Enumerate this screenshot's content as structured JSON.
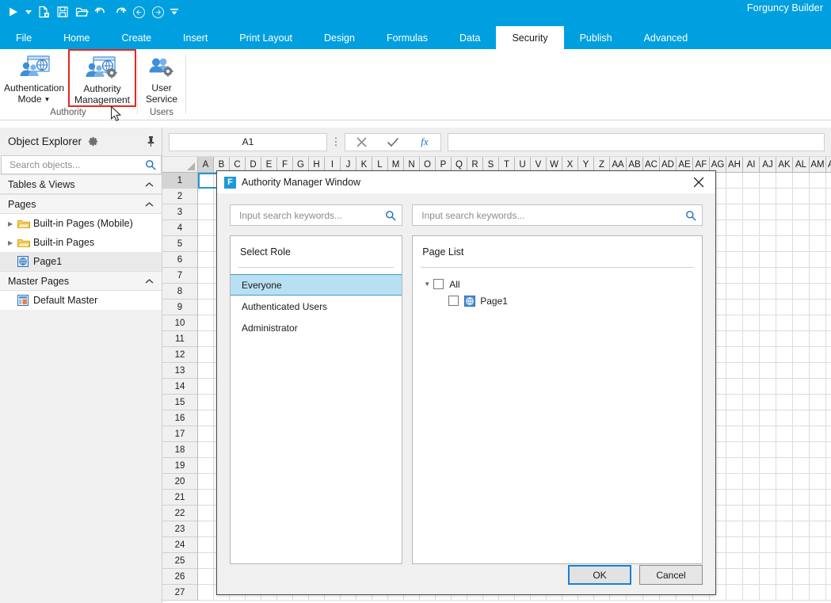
{
  "app": {
    "title": "Forguncy Builder",
    "accent": "#00a0e0",
    "selection_color": "#1c9ad6",
    "highlight_red": "#e8261d"
  },
  "quick_access": [
    {
      "name": "run-icon",
      "label": "Run"
    },
    {
      "name": "run-dropdown-icon",
      "label": "Run options"
    },
    {
      "name": "new-file-icon",
      "label": "New"
    },
    {
      "name": "save-icon",
      "label": "Save"
    },
    {
      "name": "open-folder-icon",
      "label": "Open"
    },
    {
      "name": "undo-icon",
      "label": "Undo"
    },
    {
      "name": "redo-icon",
      "label": "Redo"
    },
    {
      "name": "back-icon",
      "label": "Back"
    },
    {
      "name": "forward-icon",
      "label": "Forward"
    },
    {
      "name": "customize-toolbar-icon",
      "label": "Customize"
    }
  ],
  "tabs": [
    {
      "label": "File",
      "active": false
    },
    {
      "label": "Home",
      "active": false
    },
    {
      "label": "Create",
      "active": false
    },
    {
      "label": "Insert",
      "active": false
    },
    {
      "label": "Print Layout",
      "active": false
    },
    {
      "label": "Design",
      "active": false
    },
    {
      "label": "Formulas",
      "active": false
    },
    {
      "label": "Data",
      "active": false
    },
    {
      "label": "Security",
      "active": true
    },
    {
      "label": "Publish",
      "active": false
    },
    {
      "label": "Advanced",
      "active": false
    }
  ],
  "ribbon": {
    "groups": [
      {
        "label": "Authority",
        "buttons": [
          {
            "label_line1": "Authentication",
            "label_line2": "Mode",
            "has_caret": true,
            "selected": false,
            "icon": "authentication-mode-icon"
          },
          {
            "label_line1": "Authority",
            "label_line2": "Management",
            "has_caret": false,
            "selected": true,
            "icon": "authority-management-icon"
          }
        ]
      },
      {
        "label": "Users",
        "buttons": [
          {
            "label_line1": "User",
            "label_line2": "Service",
            "has_caret": false,
            "selected": false,
            "icon": "user-service-icon"
          }
        ]
      }
    ]
  },
  "object_explorer": {
    "title": "Object Explorer",
    "search_placeholder": "Search objects...",
    "search_value": "",
    "sections": [
      {
        "label": "Tables & Views",
        "expanded": true,
        "items": []
      },
      {
        "label": "Pages",
        "expanded": true,
        "items": [
          {
            "label": "Built-in Pages (Mobile)",
            "icon": "folder-icon",
            "arrow": true,
            "selected": false
          },
          {
            "label": "Built-in Pages",
            "icon": "folder-icon",
            "arrow": true,
            "selected": false
          },
          {
            "label": "Page1",
            "icon": "page-icon",
            "arrow": false,
            "selected": true
          }
        ]
      },
      {
        "label": "Master Pages",
        "expanded": true,
        "items": [
          {
            "label": "Default Master",
            "icon": "master-page-icon",
            "arrow": false,
            "selected": false
          }
        ]
      }
    ]
  },
  "formula_bar": {
    "name_box": "A1",
    "formula_value": "",
    "cancel_label": "✕",
    "confirm_label": "✓",
    "fx_label": "fx"
  },
  "grid": {
    "columns": [
      "A",
      "B",
      "C",
      "D",
      "E",
      "F",
      "G",
      "H",
      "I",
      "J",
      "K",
      "L",
      "M",
      "N",
      "O",
      "P",
      "Q",
      "R",
      "S",
      "T",
      "U",
      "V",
      "W",
      "X",
      "Y",
      "Z",
      "AA",
      "AB",
      "AC",
      "AD",
      "AE",
      "AF",
      "AG",
      "AH",
      "AI",
      "AJ",
      "AK",
      "AL",
      "AM",
      "AN"
    ],
    "rows": [
      1,
      2,
      3,
      4,
      5,
      6,
      7,
      8,
      9,
      10,
      11,
      12,
      13,
      14,
      15,
      16,
      17,
      18,
      19,
      20,
      21,
      22,
      23,
      24,
      25,
      26,
      27
    ],
    "selected_cell": "A1",
    "selected_column": "A",
    "selected_row": 1
  },
  "dialog": {
    "title": "Authority Manager Window",
    "logo_letter": "F",
    "close_label": "✕",
    "left_search_placeholder": "Input search keywords...",
    "left_search_value": "",
    "right_search_placeholder": "Input search keywords...",
    "right_search_value": "",
    "role_panel": {
      "title": "Select Role",
      "roles": [
        {
          "label": "Everyone",
          "selected": true
        },
        {
          "label": "Authenticated Users",
          "selected": false
        },
        {
          "label": "Administrator",
          "selected": false
        }
      ]
    },
    "page_panel": {
      "title": "Page List",
      "tree": [
        {
          "label": "All",
          "checked": false,
          "has_arrow": true,
          "expanded": true,
          "indent": 0,
          "icon": null
        },
        {
          "label": "Page1",
          "checked": false,
          "has_arrow": false,
          "expanded": false,
          "indent": 1,
          "icon": "page-icon"
        }
      ]
    },
    "buttons": [
      {
        "label": "OK",
        "primary": true
      },
      {
        "label": "Cancel",
        "primary": false
      }
    ]
  }
}
